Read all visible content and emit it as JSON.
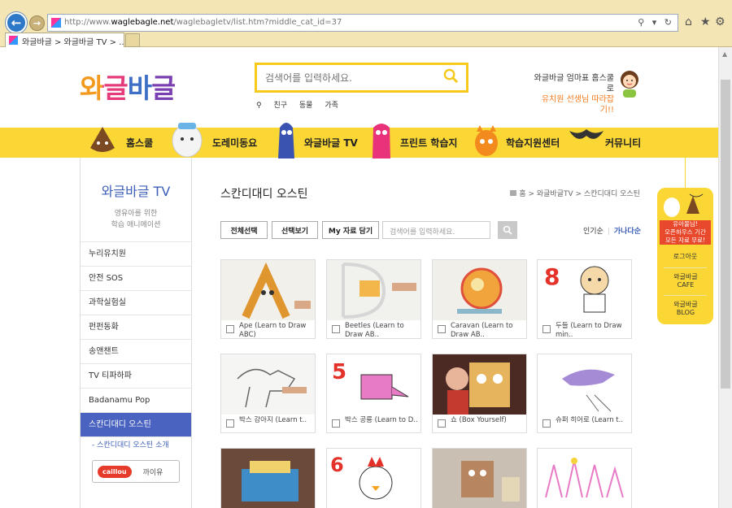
{
  "browser": {
    "url_prefix": "http://www.",
    "url_domain": "waglebagle.net",
    "url_path": "/waglebagletv/list.htm?middle_cat_id=37",
    "tab_title": "와글바글 > 와글바글 TV > ...",
    "address_tools": "⚲ ▾ ↻",
    "home_icon": "⌂",
    "favorites_icon": "★",
    "settings_icon": "⚙"
  },
  "header": {
    "logo_text": "와글바글",
    "search_placeholder": "검색어를 입력하세요.",
    "quick_links": [
      "친구",
      "동물",
      "가족"
    ],
    "promo_line1": "와글바글 엄마표 홈스쿨로",
    "promo_line2": "유치원 선생님 따라잡기!!"
  },
  "nav": {
    "items": [
      {
        "label": "홈스쿨"
      },
      {
        "label": "도레미동요"
      },
      {
        "label": "와글바글 TV"
      },
      {
        "label": "프린트 학습지"
      },
      {
        "label": "학습지원센터"
      },
      {
        "label": "커뮤니티"
      }
    ]
  },
  "sidebar": {
    "title": "와글바글 TV",
    "subtitle_line1": "영유아를 위한",
    "subtitle_line2": "학습 애니메이션",
    "items": [
      {
        "label": "누리유치원"
      },
      {
        "label": "안전 SOS"
      },
      {
        "label": "과학실험실"
      },
      {
        "label": "펀펀동화"
      },
      {
        "label": "송앤챈트"
      },
      {
        "label": "TV 티파하파"
      },
      {
        "label": "Badanamu Pop"
      },
      {
        "label": "스칸디대디 오스틴"
      }
    ],
    "sub_item": "- 스칸디대디 오스틴 소개",
    "caillou_logo": "caillou",
    "caillou_label": "까이유"
  },
  "main": {
    "title": "스칸디대디 오스틴",
    "breadcrumb": "홈 > 와글바글TV > 스칸디대디 오스틴",
    "buttons": {
      "select_all": "전체선택",
      "view_selected": "선택보기",
      "my_save": "My 자료 담기"
    },
    "search_placeholder": "검색어를 입력하세요.",
    "sort": {
      "popular": "인기순",
      "alpha": "가나다순"
    },
    "cards": [
      {
        "caption": "Ape (Learn to Draw ABC)"
      },
      {
        "caption": "Beetles (Learn to Draw AB.."
      },
      {
        "caption": "Caravan (Learn to Draw AB.."
      },
      {
        "caption": "두들 (Learn to Draw min.."
      },
      {
        "caption": "박스 강아지 (Learn t.."
      },
      {
        "caption": "박스 공룡 (Learn to D.."
      },
      {
        "caption": "쇼 (Box Yourself)"
      },
      {
        "caption": "슈퍼 히어로 (Learn t.."
      },
      {
        "caption": ""
      },
      {
        "caption": ""
      },
      {
        "caption": ""
      },
      {
        "caption": ""
      }
    ]
  },
  "quick_menu": {
    "banner_line1": "유아몰님!",
    "banner_line2": "오픈하우스 기간",
    "banner_line3": "모든 자료 무료!",
    "logout": "로그아웃",
    "cafe": "와글바글 CAFE",
    "blog": "와글바글 BLOG"
  },
  "colors": {
    "accent_yellow": "#fbd735",
    "brand_blue": "#3d5fb8",
    "active_blue": "#4a62c0"
  }
}
